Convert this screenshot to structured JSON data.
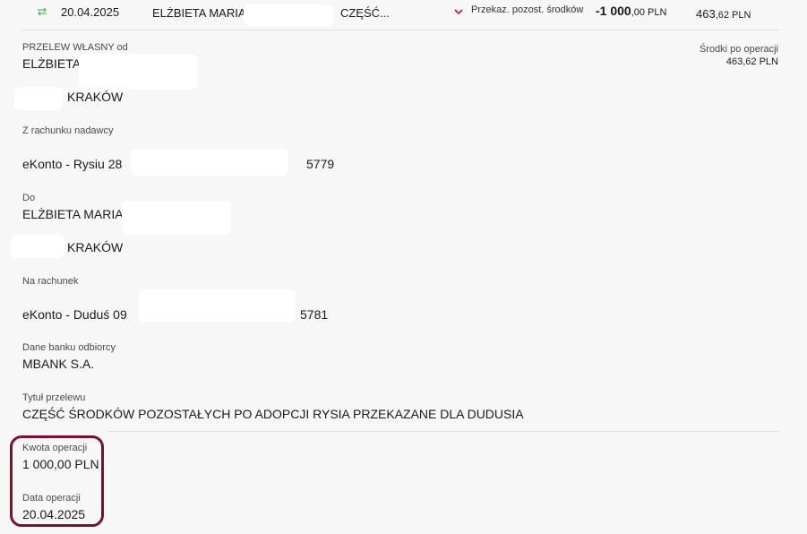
{
  "summary": {
    "date": "20.04.2025",
    "name": "ELŻBIETA MARIA",
    "title_short": "CZĘŚĆ...",
    "category": "Przekaz. pozost. środków",
    "amount_int": "-1 000",
    "amount_dec": ",00 PLN",
    "balance_int": "463",
    "balance_dec": ",62 PLN"
  },
  "details": {
    "type_label": "PRZELEW WŁASNY od",
    "sender_name": "ELŻBIETA",
    "sender_city": "KRAKÓW",
    "balance_after_label": "Środki po operacji",
    "balance_after_value": "463,62 PLN",
    "from_account_label": "Z rachunku nadawcy",
    "from_account_name": "eKonto - Rysiu 28",
    "from_account_suffix": "5779",
    "to_label": "Do",
    "recipient_name": "ELŻBIETA MARIA",
    "recipient_city": "KRAKÓW",
    "to_account_label": "Na rachunek",
    "to_account_name": "eKonto - Duduś 09",
    "to_account_suffix": "5781",
    "bank_label": "Dane banku odbiorcy",
    "bank_name": "MBANK S.A.",
    "transfer_title_label": "Tytuł przelewu",
    "transfer_title": "CZĘŚĆ ŚRODKÓW POZOSTAŁYCH PO ADOPCJI RYSIA PRZEKAZANE DLA DUDUSIA",
    "amount_label": "Kwota operacji",
    "amount_value": "1 000,00 PLN",
    "date_label": "Data operacji",
    "date_value": "20.04.2025"
  },
  "icons": {
    "transfer": "transfer-arrows-icon",
    "collapse": "chevron-down-icon"
  },
  "colors": {
    "accent_red": "#c8102e",
    "transfer_green": "#5cb85c",
    "highlight_border": "#7a1029"
  }
}
